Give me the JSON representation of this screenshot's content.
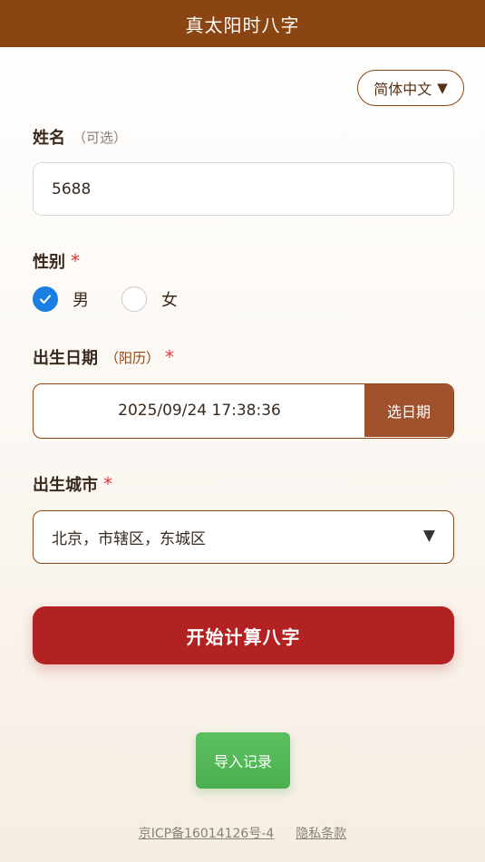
{
  "header": {
    "title": "真太阳时八字"
  },
  "language": {
    "label": "简体中文",
    "caret": "▼"
  },
  "name_field": {
    "label": "姓名",
    "hint": "（可选）",
    "value": "5688"
  },
  "gender": {
    "label": "性别",
    "required": "*",
    "options": [
      {
        "label": "男",
        "checked": true
      },
      {
        "label": "女",
        "checked": false
      }
    ]
  },
  "birth_date": {
    "label": "出生日期",
    "hint": "（阳历）",
    "required": "*",
    "value": "2025/09/24 17:38:36",
    "button": "选日期"
  },
  "birth_city": {
    "label": "出生城市",
    "required": "*",
    "value": "北京，市辖区，东城区",
    "caret": "▼"
  },
  "actions": {
    "calculate": "开始计算八字",
    "import": "导入记录"
  },
  "footer": {
    "icp": "京ICP备16014126号-4",
    "privacy": "隐私条款"
  },
  "colors": {
    "header_bg": "#8b4513",
    "calc_btn": "#b22222",
    "import_btn": "#4caf50",
    "radio_checked": "#1a7fe0",
    "required": "#e03a3a"
  }
}
